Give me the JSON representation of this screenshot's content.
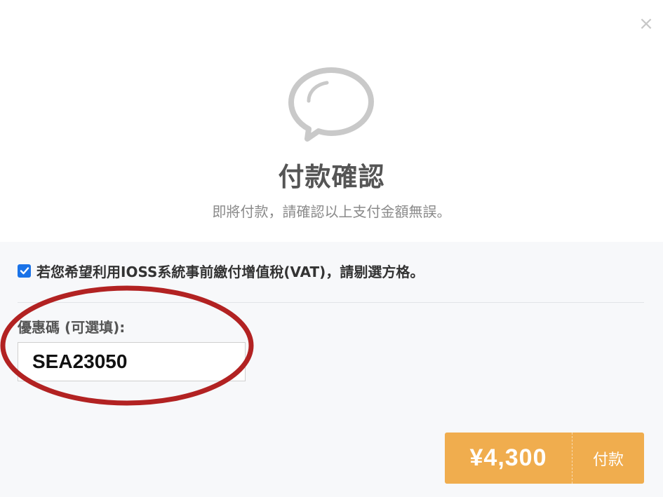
{
  "dialog": {
    "close_symbol": "×",
    "icon": "speech-bubble-icon",
    "title": "付款確認",
    "subtitle": "即將付款，請確認以上支付金額無誤。"
  },
  "ioss": {
    "checked": true,
    "label": "若您希望利用IOSS系統事前繳付增值稅(VAT)，請剔選方格。"
  },
  "coupon": {
    "label": "優惠碼 (可選填):",
    "value": "SEA23050"
  },
  "payment": {
    "amount": "¥4,300",
    "button_label": "付款"
  },
  "colors": {
    "pay_button": "#f0ad4e",
    "checkbox": "#1a73e8",
    "annotation": "#b22222",
    "lower_panel": "#f7f8fa"
  }
}
